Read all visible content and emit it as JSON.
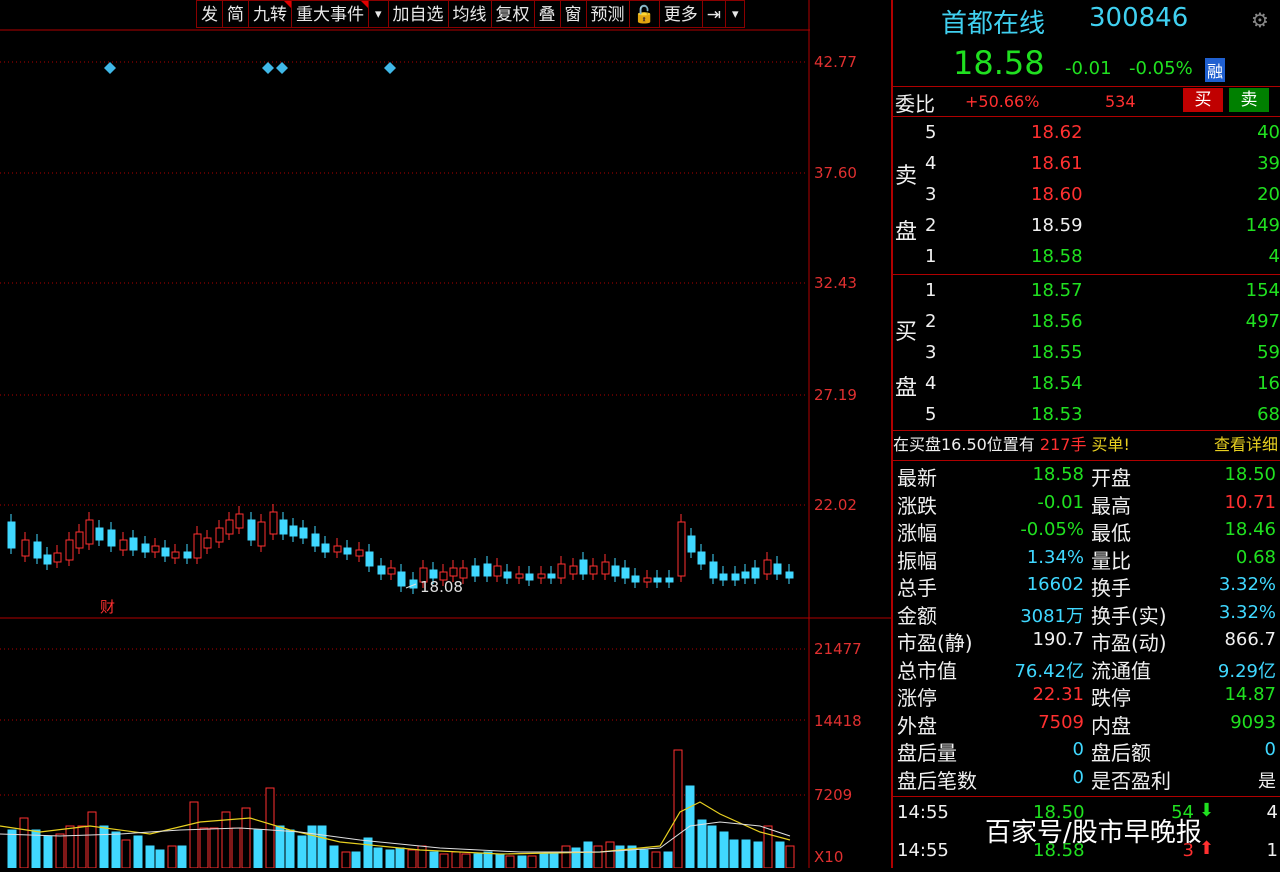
{
  "toolbar": {
    "items": [
      "发",
      "简",
      "九转",
      "重大事件",
      "▾",
      "加自选",
      "均线",
      "复权",
      "叠",
      "窗",
      "预测",
      "🔓",
      "更多",
      "⇥",
      "▾"
    ]
  },
  "price_axis": [
    "42.77",
    "37.60",
    "32.43",
    "27.19",
    "22.02"
  ],
  "volume_axis": [
    "21477",
    "14418",
    "7209",
    "X10"
  ],
  "chart_annotations": {
    "low_price": "18.08",
    "cai_marker": "财"
  },
  "stock": {
    "name": "首都在线",
    "code": "300846",
    "price": "18.58",
    "change": "-0.01",
    "change_pct": "-0.05%",
    "badge": "融"
  },
  "weibi": {
    "label": "委比",
    "value": "+50.66%",
    "diff": "534",
    "buy": "买",
    "sell": "卖"
  },
  "sell_label": [
    "卖",
    "盘"
  ],
  "buy_label": [
    "买",
    "盘"
  ],
  "asks": [
    {
      "level": "5",
      "price": "18.62",
      "vol": "40"
    },
    {
      "level": "4",
      "price": "18.61",
      "vol": "39"
    },
    {
      "level": "3",
      "price": "18.60",
      "vol": "20"
    },
    {
      "level": "2",
      "price": "18.59",
      "vol": "149"
    },
    {
      "level": "1",
      "price": "18.58",
      "vol": "4"
    }
  ],
  "bids": [
    {
      "level": "1",
      "price": "18.57",
      "vol": "154"
    },
    {
      "level": "2",
      "price": "18.56",
      "vol": "497"
    },
    {
      "level": "3",
      "price": "18.55",
      "vol": "59"
    },
    {
      "level": "4",
      "price": "18.54",
      "vol": "16"
    },
    {
      "level": "5",
      "price": "18.53",
      "vol": "68"
    }
  ],
  "notice": {
    "text1": "在买盘16.50位置有",
    "text2": "217手",
    "text3": "买单!",
    "link": "查看详细"
  },
  "stats": [
    {
      "l1": "最新",
      "v1": "18.58",
      "c1": "green",
      "l2": "开盘",
      "v2": "18.50",
      "c2": "green"
    },
    {
      "l1": "涨跌",
      "v1": "-0.01",
      "c1": "green",
      "l2": "最高",
      "v2": "10.71",
      "c2": "red"
    },
    {
      "l1": "涨幅",
      "v1": "-0.05%",
      "c1": "green",
      "l2": "最低",
      "v2": "18.46",
      "c2": "green"
    },
    {
      "l1": "振幅",
      "v1": "1.34%",
      "c1": "cyan",
      "l2": "量比",
      "v2": "0.68",
      "c2": "green"
    },
    {
      "l1": "总手",
      "v1": "16602",
      "c1": "cyan",
      "l2": "换手",
      "v2": "3.32%",
      "c2": "cyan"
    },
    {
      "l1": "金额",
      "v1": "3081万",
      "c1": "cyan",
      "l2": "换手(实)",
      "v2": "3.32%",
      "c2": "cyan"
    },
    {
      "l1": "市盈(静)",
      "v1": "190.7",
      "c1": "white",
      "l2": "市盈(动)",
      "v2": "866.7",
      "c2": "white"
    },
    {
      "l1": "总市值",
      "v1": "76.42亿",
      "c1": "cyan",
      "l2": "流通值",
      "v2": "9.29亿",
      "c2": "cyan"
    },
    {
      "l1": "涨停",
      "v1": "22.31",
      "c1": "red",
      "l2": "跌停",
      "v2": "14.87",
      "c2": "green"
    },
    {
      "l1": "外盘",
      "v1": "7509",
      "c1": "red",
      "l2": "内盘",
      "v2": "9093",
      "c2": "green"
    },
    {
      "l1": "盘后量",
      "v1": "0",
      "c1": "cyan",
      "l2": "盘后额",
      "v2": "0",
      "c2": "cyan"
    },
    {
      "l1": "盘后笔数",
      "v1": "0",
      "c1": "cyan",
      "l2": "是否盈利",
      "v2": "是",
      "c2": "white"
    }
  ],
  "ticks": [
    {
      "time": "14:55",
      "price": "18.50",
      "vol": "54",
      "dir": "down",
      "n": "4"
    },
    {
      "time": "14:55",
      "price": "18.58",
      "vol": "3",
      "dir": "up",
      "n": "1"
    }
  ],
  "watermark": "百家号/股市早晚报",
  "colors": {
    "up": "#ff3030",
    "down": "#40d8ff",
    "grid": "#b00000",
    "ma": "#e8d020"
  }
}
